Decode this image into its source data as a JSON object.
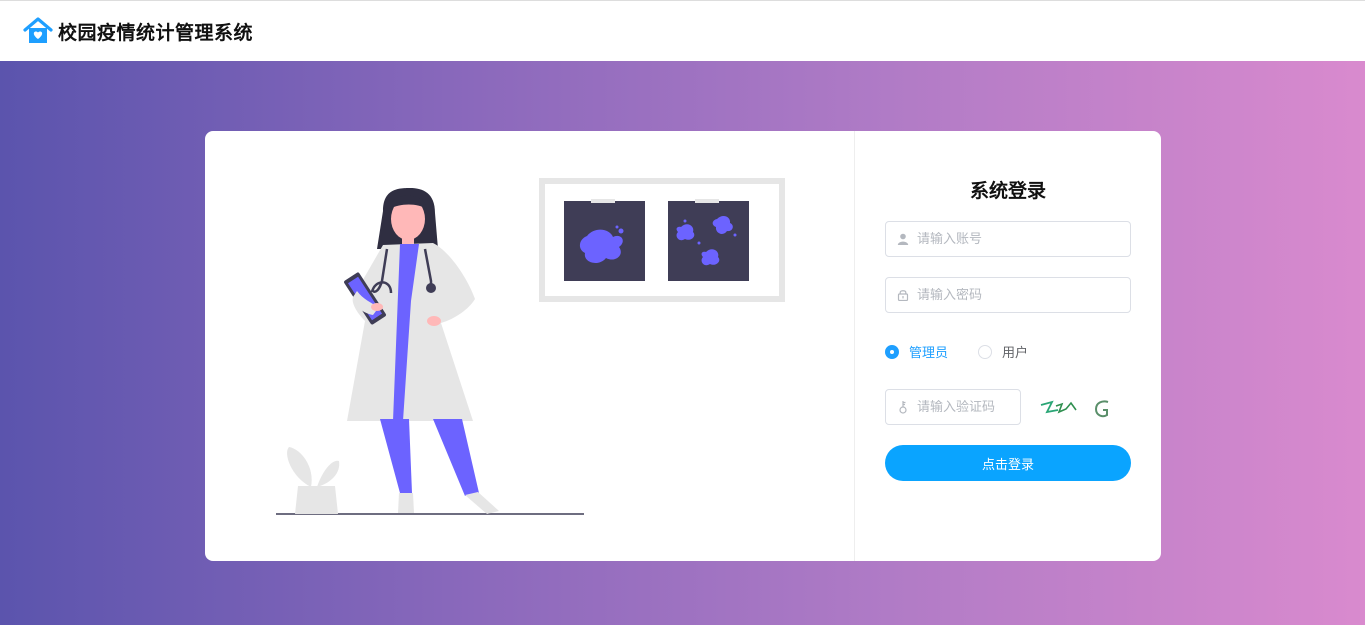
{
  "app": {
    "title": "校园疫情统计管理系统"
  },
  "login": {
    "title": "系统登录",
    "account_placeholder": "请输入账号",
    "password_placeholder": "请输入密码",
    "captcha_placeholder": "请输入验证码",
    "captcha_text": "ZZ^G",
    "roles": [
      {
        "label": "管理员",
        "selected": true
      },
      {
        "label": "用户",
        "selected": false
      }
    ],
    "submit_label": "点击登录"
  },
  "colors": {
    "accent": "#0aa4ff",
    "gradient_start": "#5b54ad",
    "gradient_end": "#d98ace",
    "illustration_purple": "#6c63ff"
  },
  "icons": [
    "home-heart-icon",
    "user-icon",
    "lock-icon",
    "key-icon"
  ]
}
